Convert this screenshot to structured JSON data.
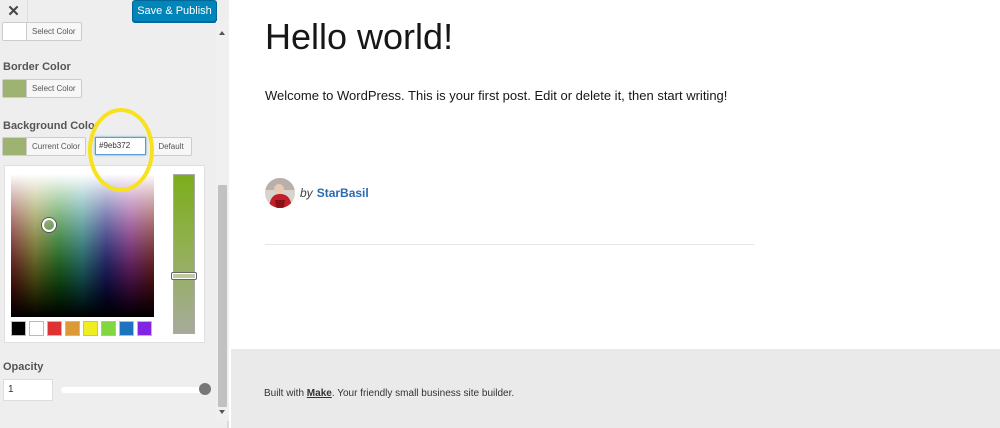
{
  "sidebar": {
    "close_glyph": "✕",
    "publish_label": "Save & Publish",
    "top_control": {
      "button_label": "Select Color",
      "swatch_color": "#ffffff"
    },
    "border_color": {
      "label": "Border Color",
      "button_label": "Select Color",
      "swatch_color": "#9eb372"
    },
    "background_color": {
      "label": "Background Color",
      "button_label": "Current Color",
      "swatch_color": "#9eb372",
      "hex_value": "#9eb372",
      "default_label": "Default"
    },
    "palette": [
      "#000000",
      "#ffffff",
      "#dd3333",
      "#dd9933",
      "#eeee22",
      "#81d742",
      "#1e73be",
      "#8224e3"
    ],
    "luminance_top": "#7cad1b",
    "luminance_bottom": "#a6ab9a",
    "opacity": {
      "label": "Opacity",
      "value": "1"
    }
  },
  "preview": {
    "post_title": "Hello world!",
    "post_body": "Welcome to WordPress. This is your first post. Edit or delete it, then start writing!",
    "byline_prefix": "by",
    "author": "StarBasil",
    "footer": {
      "prefix": "Built with ",
      "link": "Make",
      "suffix": ". Your friendly small business site builder."
    }
  }
}
